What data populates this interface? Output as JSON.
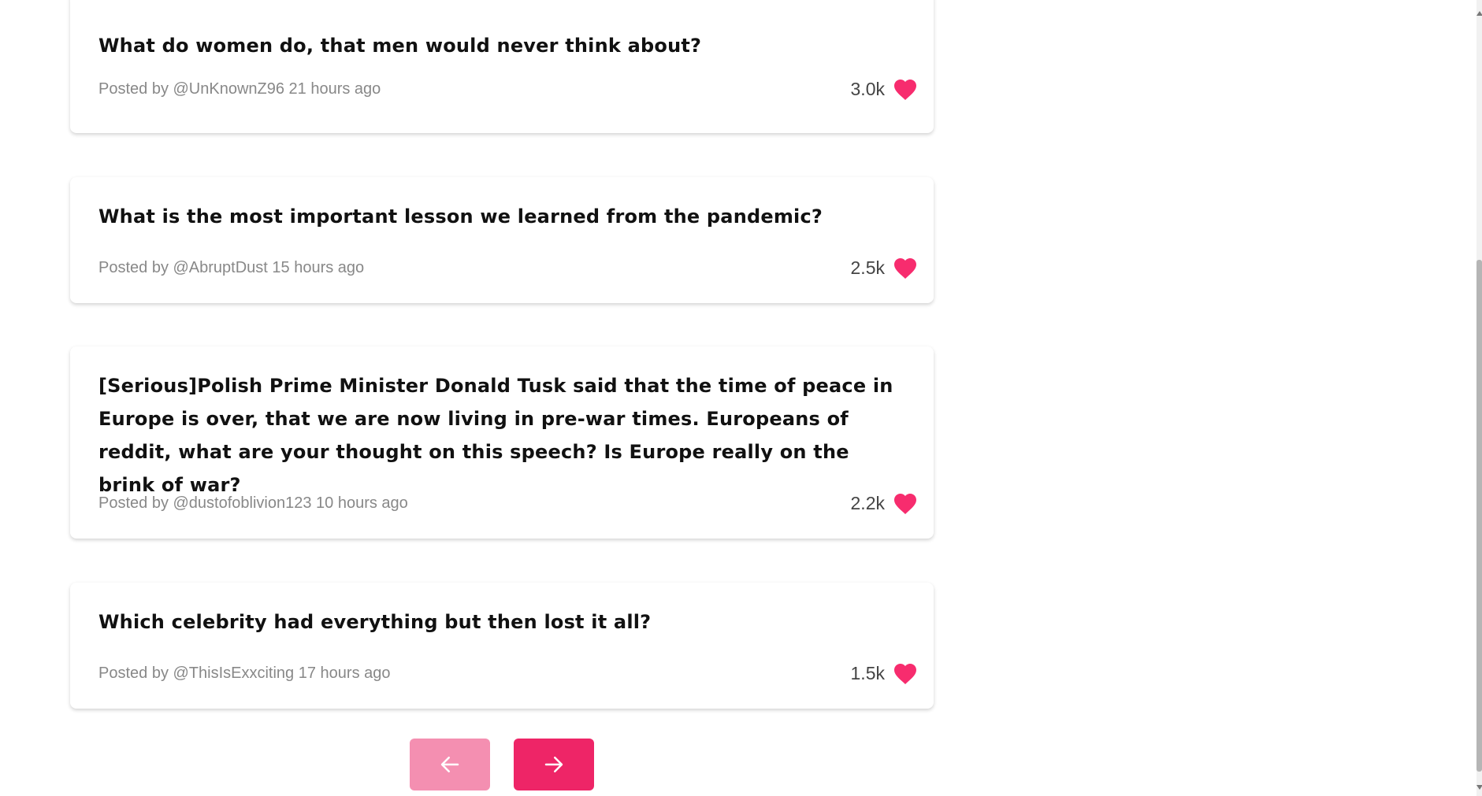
{
  "posts": [
    {
      "title": "What do women do, that men would never think about?",
      "meta": "Posted by @UnKnownZ96 21 hours ago",
      "likes": "3.0k"
    },
    {
      "title": "What is the most important lesson we learned from the pandemic?",
      "meta": "Posted by @AbruptDust 15 hours ago",
      "likes": "2.5k"
    },
    {
      "title": "[Serious]Polish Prime Minister Donald Tusk said that the time of peace in Europe is over, that we are now living in pre-war times. Europeans of reddit, what are your thought on this speech? Is Europe really on the brink of war?",
      "meta": "Posted by @dustofoblivion123 10 hours ago",
      "likes": "2.2k"
    },
    {
      "title": "Which celebrity had everything but then lost it all?",
      "meta": "Posted by @ThisIsExxciting 17 hours ago",
      "likes": "1.5k"
    }
  ],
  "icons": {
    "like": "heart-icon",
    "prev": "arrow-left-icon",
    "next": "arrow-right-icon"
  },
  "colors": {
    "accent": "#ee2567",
    "accent_light": "#f48fb1",
    "heart": "#f72c6e"
  }
}
